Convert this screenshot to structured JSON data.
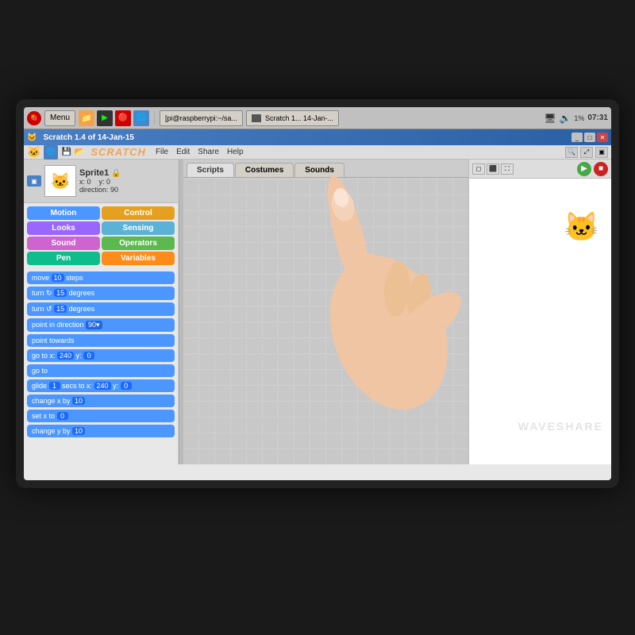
{
  "taskbar": {
    "menu_label": "Menu",
    "window1_label": "[pi@raspberrypi:~/sa...",
    "window2_label": "Scratch 1... 14-Jan-...",
    "battery_label": "1%",
    "time_label": "07:31"
  },
  "scratch_window": {
    "title": "Scratch 1.4 of 14-Jan-15",
    "logo": "SCRATCH",
    "menu_items": [
      "File",
      "Edit",
      "Share",
      "Help"
    ],
    "sprite_name": "Sprite1",
    "sprite_x": "x: 0",
    "sprite_y": "y: 0",
    "sprite_direction": "direction: 90",
    "tabs": [
      "Scripts",
      "Costumes",
      "Sounds"
    ],
    "active_tab": "Scripts"
  },
  "categories": [
    {
      "label": "Motion",
      "class": "cat-motion"
    },
    {
      "label": "Control",
      "class": "cat-control"
    },
    {
      "label": "Looks",
      "class": "cat-looks"
    },
    {
      "label": "Sensing",
      "class": "cat-sensing"
    },
    {
      "label": "Sound",
      "class": "cat-sound"
    },
    {
      "label": "Operators",
      "class": "cat-operators"
    },
    {
      "label": "Pen",
      "class": "cat-pen"
    },
    {
      "label": "Variables",
      "class": "cat-variables"
    }
  ],
  "blocks": [
    "move [10] steps",
    "turn ↻ [15] degrees",
    "turn ↺ [15] degrees",
    "point in direction [90▼]",
    "point towards",
    "go to x: [240] y: [0]",
    "go to",
    "glide [1] secs to x: [240] y: [0]",
    "change x by [10]",
    "set x to [0]",
    "change y by [10]"
  ],
  "watermark": "WAVESHARE"
}
